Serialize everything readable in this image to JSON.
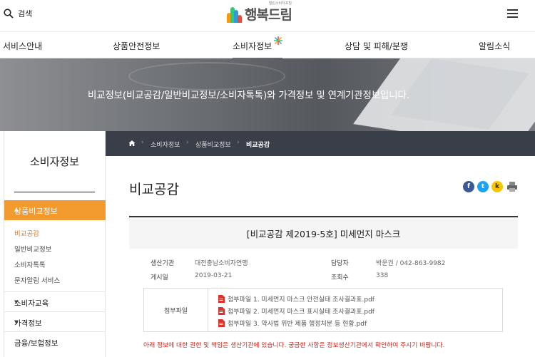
{
  "header": {
    "search_label": "검색",
    "logo_text": "행복드림",
    "logo_small": "열린소비자포털"
  },
  "nav": {
    "items": [
      {
        "label": "서비스안내"
      },
      {
        "label": "상품안전정보"
      },
      {
        "label": "소비자정보",
        "active": true
      },
      {
        "label": "상담 및 피해/분쟁"
      },
      {
        "label": "알림소식"
      }
    ]
  },
  "banner": {
    "text": "비교정보(비교공감/일반비교정보/소비자톡톡)와 가격정보 및 연계기관정보입니다."
  },
  "sidebar": {
    "title": "소비자정보",
    "active_group": "상품비교정보",
    "sub_items": [
      "비교공감",
      "일반비교정보",
      "소비자톡톡",
      "문자알림 서비스"
    ],
    "groups": [
      "소비자교육",
      "가격정보",
      "금융/보험정보"
    ]
  },
  "breadcrumb": {
    "items": [
      "소비자정보",
      "상품비교정보",
      "비교공감"
    ]
  },
  "main": {
    "title": "비교공감",
    "article": {
      "heading_prefix": "[비교공감 제2019-5호]",
      "heading_rest": "미세먼지 마스크",
      "producer_label": "생산기관",
      "producer": "대전충남소비자연맹",
      "contact_label": "담당자",
      "contact": "박운권 / 042-863-9982",
      "date_label": "게시일",
      "date": "2019-03-21",
      "views_label": "조회수",
      "views": "338",
      "attachments_label": "첨부파일",
      "attachments": [
        "첨부파일 1. 미세먼지 마스크 안전실태 조사결과표.pdf",
        "첨부파일 2. 미세먼지 마스크 표시실태 조사결과표.pdf",
        "첨부파일 3. 약사법 위반 제품 행정처분 등 현황.pdf"
      ],
      "notice": "아래 정보에 대한 권한 및 책임은 생산기관에 있습니다. 궁금한 사항은 정보생산기관에서 확인하여 주시기 바랍니다."
    }
  },
  "colors": {
    "accent_orange": "#f29a2e",
    "nav_active_underline": "#e8483a",
    "breadcrumb_bg": "#3a3e49",
    "notice_red": "#cc2a1f",
    "facebook": "#3b5998",
    "twitter": "#1da1f2",
    "kakao": "#f7c600"
  },
  "icons": [
    "search-icon",
    "hamburger-menu-icon",
    "star-sparkle-icon",
    "home-icon",
    "facebook-icon",
    "twitter-icon",
    "kakao-icon",
    "print-icon",
    "pdf-icon",
    "caret-up-icon",
    "caret-down-icon"
  ]
}
